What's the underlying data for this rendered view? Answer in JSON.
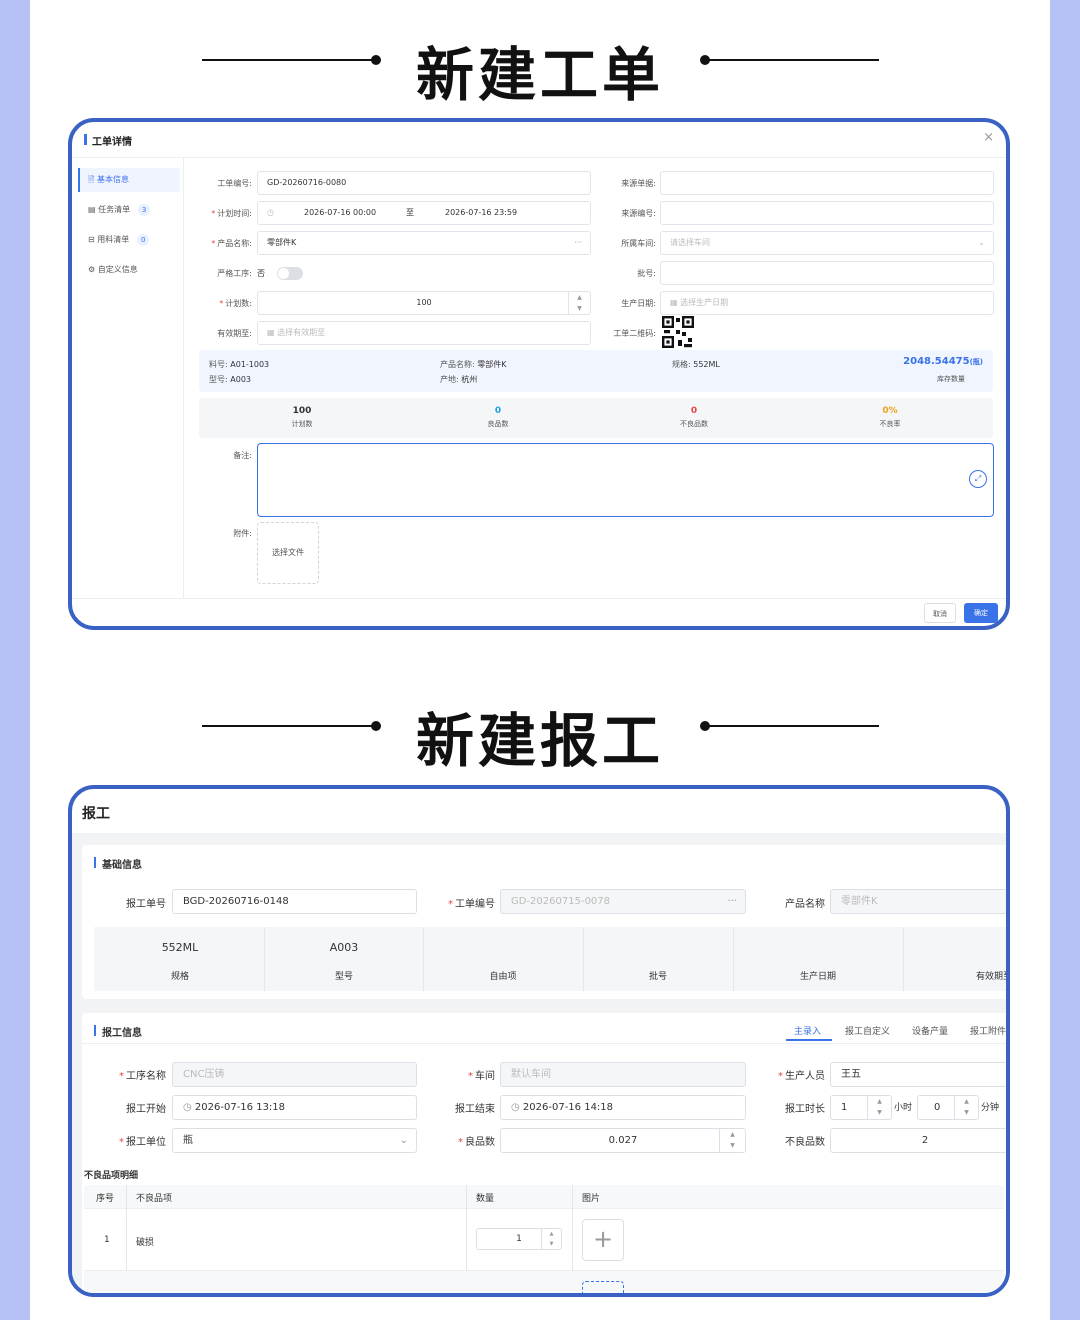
{
  "headings": {
    "work_order": "新建工单",
    "report": "新建报工"
  },
  "wo": {
    "title": "工单详情",
    "sidebar": [
      {
        "label": "基本信息",
        "count": ""
      },
      {
        "label": "任务清单",
        "count": "3"
      },
      {
        "label": "用料清单",
        "count": "0"
      },
      {
        "label": "自定义信息",
        "count": ""
      }
    ],
    "order_no_label": "工单编号:",
    "order_no": "GD-20260716-0080",
    "plan_time_label": "计划时间:",
    "plan_start": "2026-07-16 00:00",
    "to": "至",
    "plan_end": "2026-07-16 23:59",
    "product_label": "产品名称:",
    "product": "零部件K",
    "strict_label": "严格工序:",
    "strict_value": "否",
    "plan_qty_label": "计划数:",
    "plan_qty": "100",
    "expire_label": "有效期至:",
    "expire_placeholder": "选择有效期至",
    "source_doc_label": "来源单据:",
    "source_no_label": "来源编号:",
    "workshop_label": "所属车间:",
    "workshop_placeholder": "请选择车间",
    "batch_label": "批号:",
    "prod_date_label": "生产日期:",
    "prod_date_placeholder": "选择生产日期",
    "qr_label": "工单二维码:",
    "info": {
      "material_no_label": "料号:",
      "material_no": "A01-1003",
      "model_label": "型号:",
      "model": "A003",
      "pname_label": "产品名称:",
      "pname": "零部件K",
      "origin_label": "产地:",
      "origin": "杭州",
      "spec_label": "规格:",
      "spec": "552ML",
      "stock": "2048.54475",
      "stock_unit": "(瓶)",
      "stock_label": "库存数量"
    },
    "stats": [
      {
        "value": "100",
        "label": "计划数",
        "color": "#333333"
      },
      {
        "value": "0",
        "label": "良品数",
        "color": "#1f9fe0"
      },
      {
        "value": "0",
        "label": "不良品数",
        "color": "#e54545"
      },
      {
        "value": "0%",
        "label": "不良率",
        "color": "#f0a020"
      }
    ],
    "remark_label": "备注:",
    "attach_label": "附件:",
    "select_file": "选择文件",
    "cancel": "取消",
    "ok": "确定"
  },
  "rp": {
    "title": "报工",
    "basic_title": "基础信息",
    "report_no_label": "报工单号",
    "report_no": "BGD-20260716-0148",
    "order_no_label": "工单编号",
    "order_no": "GD-20260715-0078",
    "product_label": "产品名称",
    "product": "零部件K",
    "attrs": [
      {
        "value": "552ML",
        "label": "规格"
      },
      {
        "value": "A003",
        "label": "型号"
      },
      {
        "value": "",
        "label": "自由项"
      },
      {
        "value": "",
        "label": "批号"
      },
      {
        "value": "",
        "label": "生产日期"
      },
      {
        "value": "",
        "label": "有效期至"
      }
    ],
    "report_info_title": "报工信息",
    "tabs": [
      "主录入",
      "报工自定义",
      "设备产量",
      "报工附件"
    ],
    "process_label": "工序名称",
    "process": "CNC压铸",
    "workshop_label": "车间",
    "workshop": "默认车间",
    "producer_label": "生产人员",
    "producer": "王五",
    "start_label": "报工开始",
    "start": "2026-07-16 13:18",
    "end_label": "报工结束",
    "end": "2026-07-16 14:18",
    "duration_label": "报工时长",
    "hours": "1",
    "hours_unit": "小时",
    "minutes": "0",
    "minutes_unit": "分钟",
    "unit_label": "报工单位",
    "unit": "瓶",
    "good_label": "良品数",
    "good": "0.027",
    "bad_label": "不良品数",
    "bad": "2",
    "defect_title": "不良品项明细",
    "defect_headers": [
      "序号",
      "不良品项",
      "数量",
      "图片"
    ],
    "defect_rows": [
      {
        "no": "1",
        "item": "破损",
        "qty": "1"
      }
    ]
  }
}
